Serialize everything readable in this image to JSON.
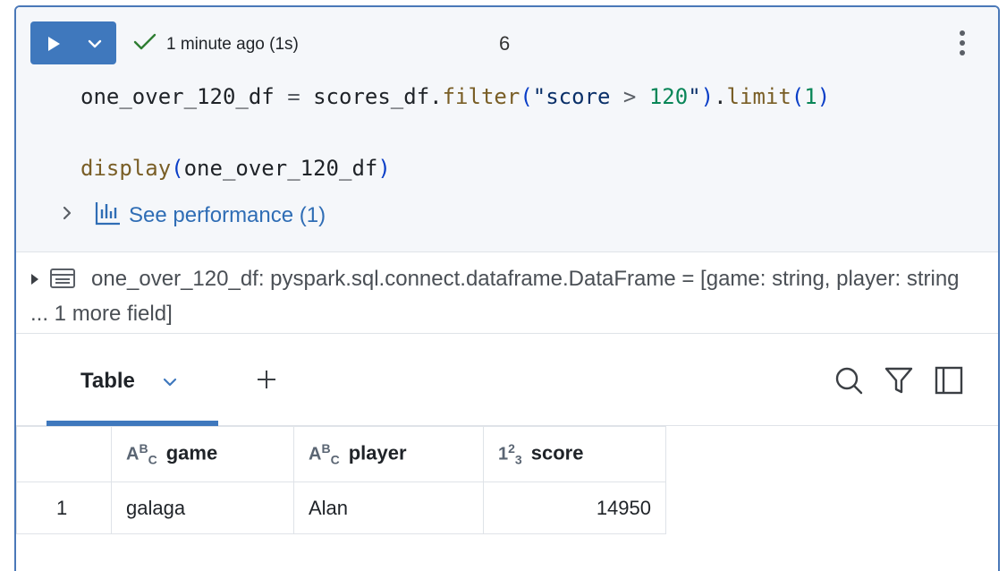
{
  "cell": {
    "status_text": "1 minute ago (1s)",
    "execution_count": "6",
    "code_line1": {
      "var": "one_over_120_df",
      "eq": " = ",
      "obj": "scores_df.",
      "filter_fn": "filter",
      "open1": "(",
      "quote_open": "\"score",
      "gt": " > ",
      "num_str": "120",
      "quote_close": "\"",
      "close1": ")",
      "dot": ".",
      "limit_fn": "limit",
      "open2": "(",
      "limit_arg": "1",
      "close2": ")"
    },
    "code_line2": {
      "fn": "display",
      "open": "(",
      "arg": "one_over_120_df",
      "close": ")"
    },
    "performance_label": "See performance (1)"
  },
  "schema": {
    "text": "one_over_120_df:  pyspark.sql.connect.dataframe.DataFrame = [game: string, player: string ... 1 more field]"
  },
  "result": {
    "tab_label": "Table",
    "columns": [
      {
        "name": "game",
        "type_icon": "ABC"
      },
      {
        "name": "player",
        "type_icon": "ABC"
      },
      {
        "name": "score",
        "type_icon": "123"
      }
    ],
    "rows": [
      {
        "index": "1",
        "game": "galaga",
        "player": "Alan",
        "score": "14950"
      }
    ]
  },
  "colors": {
    "accent": "#3f78bd",
    "success": "#2e7d32",
    "link": "#2f6db5"
  }
}
